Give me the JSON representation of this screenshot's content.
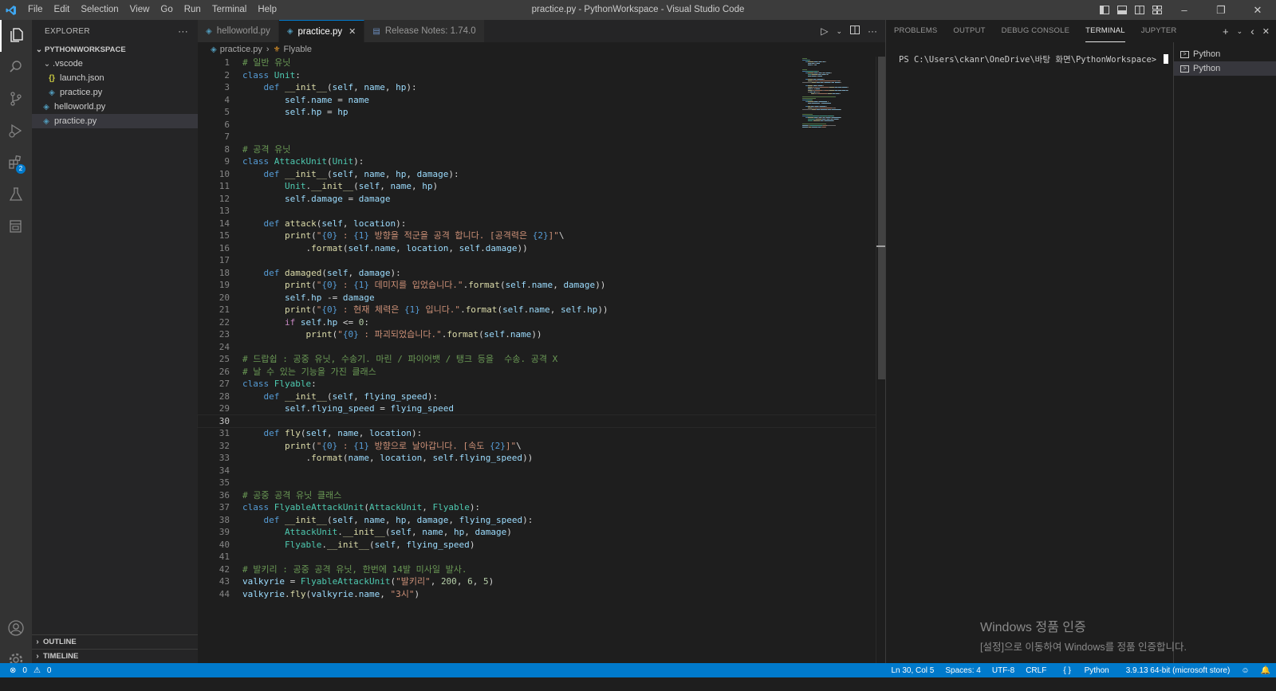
{
  "titlebar": {
    "menu": [
      "File",
      "Edit",
      "Selection",
      "View",
      "Go",
      "Run",
      "Terminal",
      "Help"
    ],
    "window_title": "practice.py - PythonWorkspace - Visual Studio Code"
  },
  "activity": {
    "extensions_badge": "2"
  },
  "explorer": {
    "header": "EXPLORER",
    "more": "···",
    "workspace": "PYTHONWORKSPACE",
    "items": [
      {
        "label": ".vscode",
        "type": "folder"
      },
      {
        "label": "launch.json",
        "type": "json"
      },
      {
        "label": "practice.py",
        "type": "py"
      },
      {
        "label": "helloworld.py",
        "type": "py"
      },
      {
        "label": "practice.py",
        "type": "py"
      }
    ],
    "outline": "OUTLINE",
    "timeline": "TIMELINE"
  },
  "tabs": [
    {
      "label": "helloworld.py",
      "active": false
    },
    {
      "label": "practice.py",
      "active": true
    },
    {
      "label": "Release Notes: 1.74.0",
      "active": false
    }
  ],
  "breadcrumb": {
    "file": "practice.py",
    "symbol": "Flyable"
  },
  "code": {
    "current_line": 30,
    "lines": [
      [
        [
          "cm",
          "# 일반 유닛"
        ]
      ],
      [
        [
          "kw",
          "class "
        ],
        [
          "cls",
          "Unit"
        ],
        [
          "t",
          ":"
        ]
      ],
      [
        [
          "t",
          "    "
        ],
        [
          "kw",
          "def "
        ],
        [
          "fn",
          "__init__"
        ],
        [
          "t",
          "("
        ],
        [
          "var",
          "self"
        ],
        [
          "t",
          ", "
        ],
        [
          "var",
          "name"
        ],
        [
          "t",
          ", "
        ],
        [
          "var",
          "hp"
        ],
        [
          "t",
          "):"
        ]
      ],
      [
        [
          "t",
          "        "
        ],
        [
          "var",
          "self"
        ],
        [
          "t",
          "."
        ],
        [
          "var",
          "name"
        ],
        [
          "t",
          " = "
        ],
        [
          "var",
          "name"
        ]
      ],
      [
        [
          "t",
          "        "
        ],
        [
          "var",
          "self"
        ],
        [
          "t",
          "."
        ],
        [
          "var",
          "hp"
        ],
        [
          "t",
          " = "
        ],
        [
          "var",
          "hp"
        ]
      ],
      [],
      [],
      [
        [
          "cm",
          "# 공격 유닛"
        ]
      ],
      [
        [
          "kw",
          "class "
        ],
        [
          "cls",
          "AttackUnit"
        ],
        [
          "t",
          "("
        ],
        [
          "cls",
          "Unit"
        ],
        [
          "t",
          "):"
        ]
      ],
      [
        [
          "t",
          "    "
        ],
        [
          "kw",
          "def "
        ],
        [
          "fn",
          "__init__"
        ],
        [
          "t",
          "("
        ],
        [
          "var",
          "self"
        ],
        [
          "t",
          ", "
        ],
        [
          "var",
          "name"
        ],
        [
          "t",
          ", "
        ],
        [
          "var",
          "hp"
        ],
        [
          "t",
          ", "
        ],
        [
          "var",
          "damage"
        ],
        [
          "t",
          "):"
        ]
      ],
      [
        [
          "t",
          "        "
        ],
        [
          "cls",
          "Unit"
        ],
        [
          "t",
          "."
        ],
        [
          "fn",
          "__init__"
        ],
        [
          "t",
          "("
        ],
        [
          "var",
          "self"
        ],
        [
          "t",
          ", "
        ],
        [
          "var",
          "name"
        ],
        [
          "t",
          ", "
        ],
        [
          "var",
          "hp"
        ],
        [
          "t",
          ")"
        ]
      ],
      [
        [
          "t",
          "        "
        ],
        [
          "var",
          "self"
        ],
        [
          "t",
          "."
        ],
        [
          "var",
          "damage"
        ],
        [
          "t",
          " = "
        ],
        [
          "var",
          "damage"
        ]
      ],
      [],
      [
        [
          "t",
          "    "
        ],
        [
          "kw",
          "def "
        ],
        [
          "fn",
          "attack"
        ],
        [
          "t",
          "("
        ],
        [
          "var",
          "self"
        ],
        [
          "t",
          ", "
        ],
        [
          "var",
          "location"
        ],
        [
          "t",
          "):"
        ]
      ],
      [
        [
          "t",
          "        "
        ],
        [
          "fn",
          "print"
        ],
        [
          "t",
          "("
        ],
        [
          "str",
          "\""
        ],
        [
          "ph",
          "{0}"
        ],
        [
          "str",
          " : "
        ],
        [
          "ph",
          "{1}"
        ],
        [
          "str",
          " 방향을 적군을 공격 합니다. [공격력은 "
        ],
        [
          "ph",
          "{2}"
        ],
        [
          "str",
          "]\""
        ],
        [
          "t",
          "\\"
        ]
      ],
      [
        [
          "t",
          "            ."
        ],
        [
          "fn",
          "format"
        ],
        [
          "t",
          "("
        ],
        [
          "var",
          "self"
        ],
        [
          "t",
          "."
        ],
        [
          "var",
          "name"
        ],
        [
          "t",
          ", "
        ],
        [
          "var",
          "location"
        ],
        [
          "t",
          ", "
        ],
        [
          "var",
          "self"
        ],
        [
          "t",
          "."
        ],
        [
          "var",
          "damage"
        ],
        [
          "t",
          "))"
        ]
      ],
      [],
      [
        [
          "t",
          "    "
        ],
        [
          "kw",
          "def "
        ],
        [
          "fn",
          "damaged"
        ],
        [
          "t",
          "("
        ],
        [
          "var",
          "self"
        ],
        [
          "t",
          ", "
        ],
        [
          "var",
          "damage"
        ],
        [
          "t",
          "):"
        ]
      ],
      [
        [
          "t",
          "        "
        ],
        [
          "fn",
          "print"
        ],
        [
          "t",
          "("
        ],
        [
          "str",
          "\""
        ],
        [
          "ph",
          "{0}"
        ],
        [
          "str",
          " : "
        ],
        [
          "ph",
          "{1}"
        ],
        [
          "str",
          " 데미지를 입었습니다.\""
        ],
        [
          "t",
          "."
        ],
        [
          "fn",
          "format"
        ],
        [
          "t",
          "("
        ],
        [
          "var",
          "self"
        ],
        [
          "t",
          "."
        ],
        [
          "var",
          "name"
        ],
        [
          "t",
          ", "
        ],
        [
          "var",
          "damage"
        ],
        [
          "t",
          "))"
        ]
      ],
      [
        [
          "t",
          "        "
        ],
        [
          "var",
          "self"
        ],
        [
          "t",
          "."
        ],
        [
          "var",
          "hp"
        ],
        [
          "t",
          " -= "
        ],
        [
          "var",
          "damage"
        ]
      ],
      [
        [
          "t",
          "        "
        ],
        [
          "fn",
          "print"
        ],
        [
          "t",
          "("
        ],
        [
          "str",
          "\""
        ],
        [
          "ph",
          "{0}"
        ],
        [
          "str",
          " : 현재 체력은 "
        ],
        [
          "ph",
          "{1}"
        ],
        [
          "str",
          " 입니다.\""
        ],
        [
          "t",
          "."
        ],
        [
          "fn",
          "format"
        ],
        [
          "t",
          "("
        ],
        [
          "var",
          "self"
        ],
        [
          "t",
          "."
        ],
        [
          "var",
          "name"
        ],
        [
          "t",
          ", "
        ],
        [
          "var",
          "self"
        ],
        [
          "t",
          "."
        ],
        [
          "var",
          "hp"
        ],
        [
          "t",
          "))"
        ]
      ],
      [
        [
          "t",
          "        "
        ],
        [
          "ctl",
          "if "
        ],
        [
          "var",
          "self"
        ],
        [
          "t",
          "."
        ],
        [
          "var",
          "hp"
        ],
        [
          "t",
          " <= "
        ],
        [
          "num",
          "0"
        ],
        [
          "t",
          ":"
        ]
      ],
      [
        [
          "t",
          "            "
        ],
        [
          "fn",
          "print"
        ],
        [
          "t",
          "("
        ],
        [
          "str",
          "\""
        ],
        [
          "ph",
          "{0}"
        ],
        [
          "str",
          " : 파괴되었습니다.\""
        ],
        [
          "t",
          "."
        ],
        [
          "fn",
          "format"
        ],
        [
          "t",
          "("
        ],
        [
          "var",
          "self"
        ],
        [
          "t",
          "."
        ],
        [
          "var",
          "name"
        ],
        [
          "t",
          "))"
        ]
      ],
      [],
      [
        [
          "cm",
          "# 드랍쉽 : 공중 유닛, 수송기. 마린 / 파이어뱃 / 탱크 등을  수송. 공격 X"
        ]
      ],
      [
        [
          "cm",
          "# 날 수 있는 기능을 가진 클래스"
        ]
      ],
      [
        [
          "kw",
          "class "
        ],
        [
          "cls",
          "Flyable"
        ],
        [
          "t",
          ":"
        ]
      ],
      [
        [
          "t",
          "    "
        ],
        [
          "kw",
          "def "
        ],
        [
          "fn",
          "__init__"
        ],
        [
          "t",
          "("
        ],
        [
          "var",
          "self"
        ],
        [
          "t",
          ", "
        ],
        [
          "var",
          "flying_speed"
        ],
        [
          "t",
          "):"
        ]
      ],
      [
        [
          "t",
          "        "
        ],
        [
          "var",
          "self"
        ],
        [
          "t",
          "."
        ],
        [
          "var",
          "flying_speed"
        ],
        [
          "t",
          " = "
        ],
        [
          "var",
          "flying_speed"
        ]
      ],
      [],
      [
        [
          "t",
          "    "
        ],
        [
          "kw",
          "def "
        ],
        [
          "fn",
          "fly"
        ],
        [
          "t",
          "("
        ],
        [
          "var",
          "self"
        ],
        [
          "t",
          ", "
        ],
        [
          "var",
          "name"
        ],
        [
          "t",
          ", "
        ],
        [
          "var",
          "location"
        ],
        [
          "t",
          "):"
        ]
      ],
      [
        [
          "t",
          "        "
        ],
        [
          "fn",
          "print"
        ],
        [
          "t",
          "("
        ],
        [
          "str",
          "\""
        ],
        [
          "ph",
          "{0}"
        ],
        [
          "str",
          " : "
        ],
        [
          "ph",
          "{1}"
        ],
        [
          "str",
          " 방향으로 날아갑니다. [속도 "
        ],
        [
          "ph",
          "{2}"
        ],
        [
          "str",
          "]\""
        ],
        [
          "t",
          "\\"
        ]
      ],
      [
        [
          "t",
          "            ."
        ],
        [
          "fn",
          "format"
        ],
        [
          "t",
          "("
        ],
        [
          "var",
          "name"
        ],
        [
          "t",
          ", "
        ],
        [
          "var",
          "location"
        ],
        [
          "t",
          ", "
        ],
        [
          "var",
          "self"
        ],
        [
          "t",
          "."
        ],
        [
          "var",
          "flying_speed"
        ],
        [
          "t",
          "))"
        ]
      ],
      [],
      [],
      [
        [
          "cm",
          "# 공중 공격 유닛 클래스"
        ]
      ],
      [
        [
          "kw",
          "class "
        ],
        [
          "cls",
          "FlyableAttackUnit"
        ],
        [
          "t",
          "("
        ],
        [
          "cls",
          "AttackUnit"
        ],
        [
          "t",
          ", "
        ],
        [
          "cls",
          "Flyable"
        ],
        [
          "t",
          "):"
        ]
      ],
      [
        [
          "t",
          "    "
        ],
        [
          "kw",
          "def "
        ],
        [
          "fn",
          "__init__"
        ],
        [
          "t",
          "("
        ],
        [
          "var",
          "self"
        ],
        [
          "t",
          ", "
        ],
        [
          "var",
          "name"
        ],
        [
          "t",
          ", "
        ],
        [
          "var",
          "hp"
        ],
        [
          "t",
          ", "
        ],
        [
          "var",
          "damage"
        ],
        [
          "t",
          ", "
        ],
        [
          "var",
          "flying_speed"
        ],
        [
          "t",
          "):"
        ]
      ],
      [
        [
          "t",
          "        "
        ],
        [
          "cls",
          "AttackUnit"
        ],
        [
          "t",
          "."
        ],
        [
          "fn",
          "__init__"
        ],
        [
          "t",
          "("
        ],
        [
          "var",
          "self"
        ],
        [
          "t",
          ", "
        ],
        [
          "var",
          "name"
        ],
        [
          "t",
          ", "
        ],
        [
          "var",
          "hp"
        ],
        [
          "t",
          ", "
        ],
        [
          "var",
          "damage"
        ],
        [
          "t",
          ")"
        ]
      ],
      [
        [
          "t",
          "        "
        ],
        [
          "cls",
          "Flyable"
        ],
        [
          "t",
          "."
        ],
        [
          "fn",
          "__init__"
        ],
        [
          "t",
          "("
        ],
        [
          "var",
          "self"
        ],
        [
          "t",
          ", "
        ],
        [
          "var",
          "flying_speed"
        ],
        [
          "t",
          ")"
        ]
      ],
      [],
      [
        [
          "cm",
          "# 발키리 : 공중 공격 유닛, 한번에 14발 미사일 발사."
        ]
      ],
      [
        [
          "var",
          "valkyrie"
        ],
        [
          "t",
          " = "
        ],
        [
          "cls",
          "FlyableAttackUnit"
        ],
        [
          "t",
          "("
        ],
        [
          "str",
          "\"발키리\""
        ],
        [
          "t",
          ", "
        ],
        [
          "num",
          "200"
        ],
        [
          "t",
          ", "
        ],
        [
          "num",
          "6"
        ],
        [
          "t",
          ", "
        ],
        [
          "num",
          "5"
        ],
        [
          "t",
          ")"
        ]
      ],
      [
        [
          "var",
          "valkyrie"
        ],
        [
          "t",
          "."
        ],
        [
          "fn",
          "fly"
        ],
        [
          "t",
          "("
        ],
        [
          "var",
          "valkyrie"
        ],
        [
          "t",
          "."
        ],
        [
          "var",
          "name"
        ],
        [
          "t",
          ", "
        ],
        [
          "str",
          "\"3시\""
        ],
        [
          "t",
          ")"
        ]
      ]
    ]
  },
  "panel": {
    "tabs": [
      "PROBLEMS",
      "OUTPUT",
      "DEBUG CONSOLE",
      "TERMINAL",
      "JUPYTER"
    ],
    "active_tab": "TERMINAL",
    "prompt": "PS C:\\Users\\ckanr\\OneDrive\\바탕 화면\\PythonWorkspace> ",
    "terminals": [
      "Python",
      "Python"
    ]
  },
  "watermark": {
    "line1": "Windows 정품 인증",
    "line2": "[설정]으로 이동하여 Windows를 정품 인증합니다."
  },
  "status": {
    "errors": "0",
    "warnings": "0",
    "position": "Ln 30, Col 5",
    "spaces": "Spaces: 4",
    "encoding": "UTF-8",
    "eol": "CRLF",
    "language": "Python",
    "interpreter": "3.9.13 64-bit (microsoft store)"
  },
  "colors": {
    "accent": "#007acc",
    "statusbar": "#007acc"
  }
}
